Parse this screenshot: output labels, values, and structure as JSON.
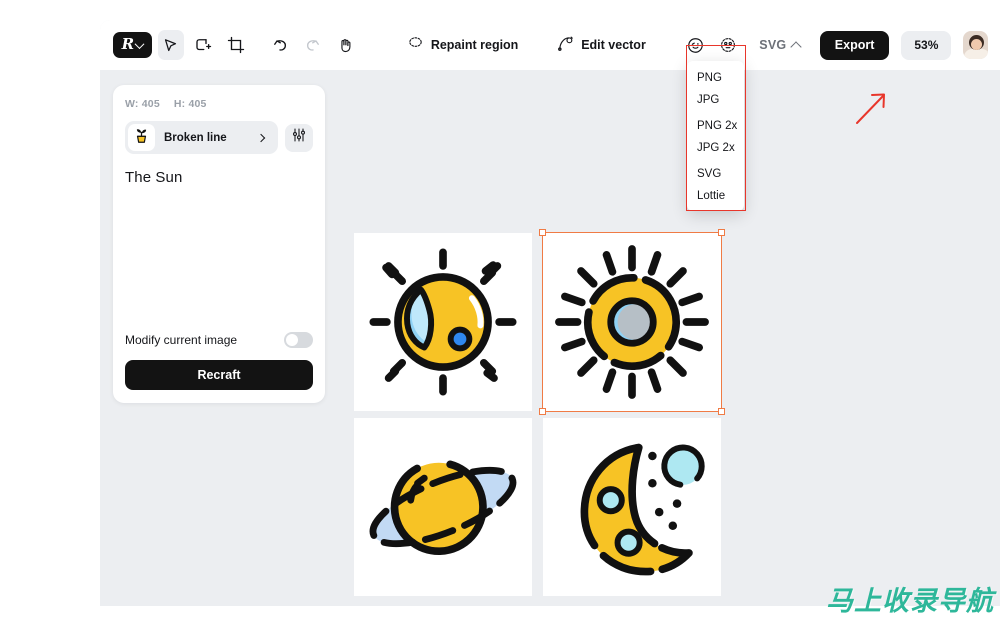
{
  "app": {
    "zoom_level": "53%",
    "logo_letter": "R"
  },
  "toolbar": {
    "tools": [
      {
        "name": "select-tool",
        "icon": "cursor-arrow-icon",
        "active": true
      },
      {
        "name": "add-shape-tool",
        "icon": "shape-plus-icon",
        "active": false
      },
      {
        "name": "crop-tool",
        "icon": "crop-frame-icon",
        "active": false
      },
      {
        "name": "undo-tool",
        "icon": "undo-arrow-icon",
        "active": false
      },
      {
        "name": "redo-tool",
        "icon": "redo-arrow-icon",
        "active": false
      },
      {
        "name": "pan-tool",
        "icon": "hand-icon",
        "active": false
      }
    ],
    "repaint_region_label": "Repaint region",
    "edit_vector_label": "Edit vector",
    "format_label": "SVG",
    "export_label": "Export"
  },
  "format_menu": {
    "items": [
      "PNG",
      "JPG",
      "PNG 2x",
      "JPG 2x",
      "SVG",
      "Lottie"
    ],
    "highlight_color": "#e8362b"
  },
  "panel": {
    "width_label": "W: 405",
    "height_label": "H: 405",
    "style_name": "Broken line",
    "prompt": "The Sun",
    "modify_label": "Modify current image",
    "modify_enabled": false,
    "recraft_label": "Recraft"
  },
  "canvas": {
    "selection_color": "#f07b45",
    "background": "#eceef1",
    "images": [
      {
        "name": "sun-partial-illustration",
        "alt": "Sun with blue cloud shape and dot"
      },
      {
        "name": "sun-ring-illustration",
        "alt": "Sun with grey-blue core and rays",
        "selected": true
      },
      {
        "name": "saturn-illustration",
        "alt": "Yellow planet with ring"
      },
      {
        "name": "moon-illustration",
        "alt": "Crescent moon with stars"
      }
    ]
  },
  "watermark": {
    "text": "马上收录导航",
    "color": "#2eb79a"
  }
}
